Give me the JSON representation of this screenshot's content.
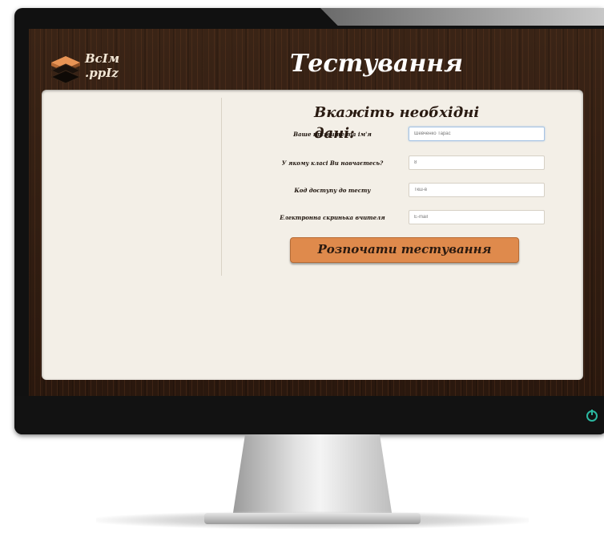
{
  "header": {
    "logo_line1": "ВсIм",
    "logo_line2": ".ppIz",
    "title": "Тестування"
  },
  "form": {
    "heading": "Вкажіть необхідні дані:",
    "fields": [
      {
        "label": "Ваше прізвище та ім'я",
        "placeholder": "Шевченко Тарас"
      },
      {
        "label": "У якому класі Ви навчаєтесь?",
        "placeholder": "8"
      },
      {
        "label": "Код доступу до тесту",
        "placeholder": "Ткш-в"
      },
      {
        "label": "Електронна скринька вчителя",
        "placeholder": "Е-mail"
      }
    ],
    "submit_label": "Розпочати тестування"
  },
  "colors": {
    "accent_button": "#df8a4c",
    "panel_bg": "#f3efe7",
    "wood_dark": "#2b1a10",
    "power_led": "#2bb7a0"
  },
  "icons": {
    "logo": "books-stack-icon",
    "power": "power-icon"
  }
}
